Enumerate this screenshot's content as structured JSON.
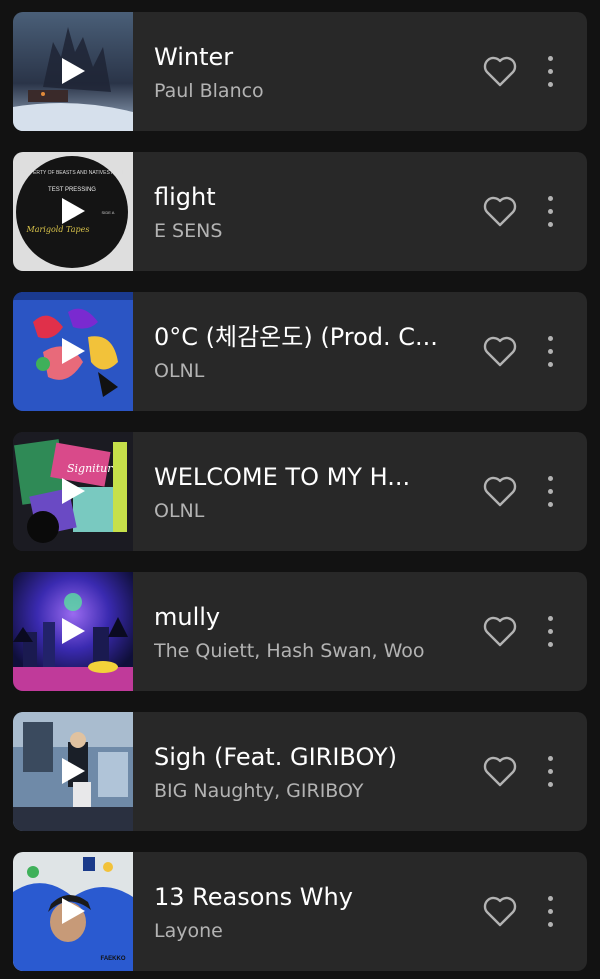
{
  "tracks": [
    {
      "title": "Winter",
      "artist": "Paul Blanco",
      "art": "winter-cover"
    },
    {
      "title": "flight",
      "artist": "E SENS",
      "art": "vinyl-test-pressing-cover",
      "art_text": {
        "top": "PROPERTY OF\nBEASTS AND NATIVES ALIKE",
        "label": "TEST PRESSING",
        "side": "SIDE A",
        "script": "Marigold Tapes"
      }
    },
    {
      "title": "0°C (체감온도) (Prod. C...",
      "artist": "OLNL",
      "art": "abstract-blue-cover"
    },
    {
      "title": "WELCOME TO MY H...",
      "artist": "OLNL",
      "art": "signiture-collage-cover",
      "art_text": {
        "sticker": "Signiture"
      }
    },
    {
      "title": "mully",
      "artist": "The Quiett, Hash Swan, Woo",
      "art": "neon-city-cover"
    },
    {
      "title": "Sigh (Feat. GIRIBOY)",
      "artist": "BIG Naughty, GIRIBOY",
      "art": "photo-room-cover"
    },
    {
      "title": "13 Reasons Why",
      "artist": "Layone",
      "art": "blue-jacket-cover",
      "art_text": {
        "logo": "FAEKKO"
      }
    }
  ],
  "colors": {
    "card": "#282828",
    "background": "#121212",
    "subtitle": "#b3b3b3"
  }
}
